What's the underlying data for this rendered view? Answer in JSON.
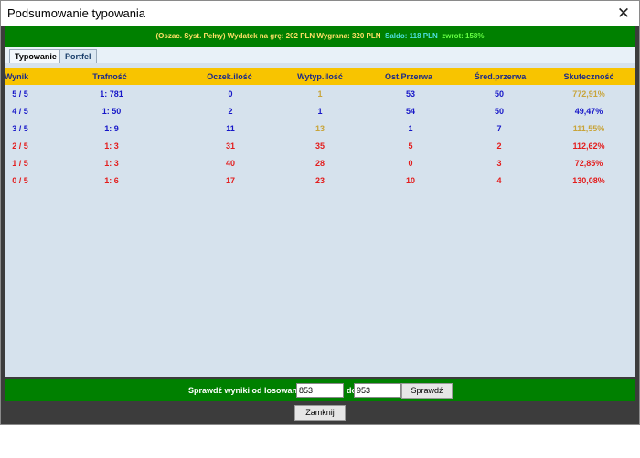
{
  "window": {
    "title": "Podsumowanie typowania"
  },
  "summary": {
    "part1": "(Oszac. Syst. Pełny)  Wydatek na grę: 202 PLN  Wygrana: 320 PLN",
    "part2": "Saldo: 118 PLN",
    "part3": "zwrot: 158%"
  },
  "tabs": [
    "Typowanie",
    "Portfel"
  ],
  "table": {
    "headers": [
      "Wynik",
      "Trafność",
      "Oczek.ilość",
      "Wytyp.ilość",
      "Ost.Przerwa",
      "Śred.przerwa",
      "Skuteczność"
    ],
    "rows": [
      [
        "5 / 5",
        "1: 781",
        "0",
        "1",
        "53",
        "50",
        "772,91%"
      ],
      [
        "4 / 5",
        "1: 50",
        "2",
        "1",
        "54",
        "50",
        "49,47%"
      ],
      [
        "3 / 5",
        "1: 9",
        "11",
        "13",
        "1",
        "7",
        "111,55%"
      ],
      [
        "2 / 5",
        "1: 3",
        "31",
        "35",
        "5",
        "2",
        "112,62%"
      ],
      [
        "1 / 5",
        "1: 3",
        "40",
        "28",
        "0",
        "3",
        "72,85%"
      ],
      [
        "0 / 5",
        "1: 6",
        "17",
        "23",
        "10",
        "4",
        "130,08%"
      ]
    ]
  },
  "check": {
    "label": "Sprawdź wyniki od losowania:",
    "from": "853",
    "to_label": "do",
    "to": "953",
    "button": "Sprawdź"
  },
  "close_button": "Zamknij",
  "colors": {
    "green": "#008000",
    "header": "#f8c400",
    "blue": "#1616c8",
    "red": "#e31c1c",
    "gold": "#c8a43a"
  }
}
